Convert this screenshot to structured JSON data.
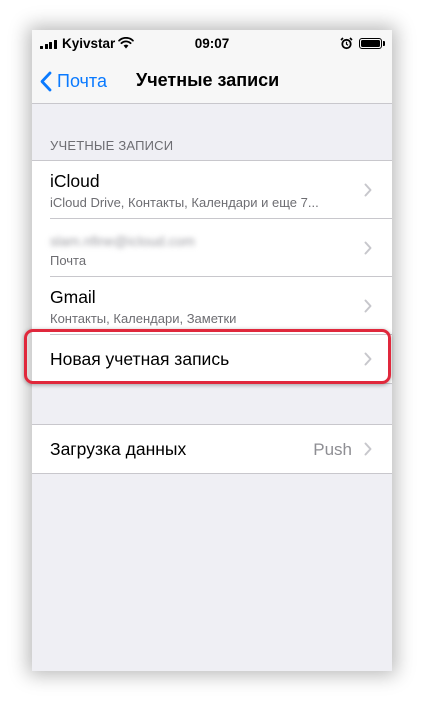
{
  "status_bar": {
    "carrier": "Kyivstar",
    "time": "09:07"
  },
  "nav": {
    "back_label": "Почта",
    "title": "Учетные записи"
  },
  "accounts_section": {
    "header": "УЧЕТНЫЕ ЗАПИСИ",
    "rows": [
      {
        "title": "iCloud",
        "subtitle": "iCloud Drive, Контакты, Календари и еще 7..."
      },
      {
        "title": "slam.nfine@icloud.com",
        "subtitle": "Почта"
      },
      {
        "title": "Gmail",
        "subtitle": "Контакты, Календари, Заметки"
      },
      {
        "title": "Новая учетная запись"
      }
    ]
  },
  "fetch_section": {
    "title": "Загрузка данных",
    "value": "Push"
  },
  "colors": {
    "accent": "#0a7aff",
    "highlight": "#e0283c",
    "background": "#efeff4"
  },
  "icons": [
    "signal-icon",
    "wifi-icon",
    "alarm-icon",
    "battery-icon",
    "back-chevron-icon",
    "chevron-right-icon"
  ]
}
